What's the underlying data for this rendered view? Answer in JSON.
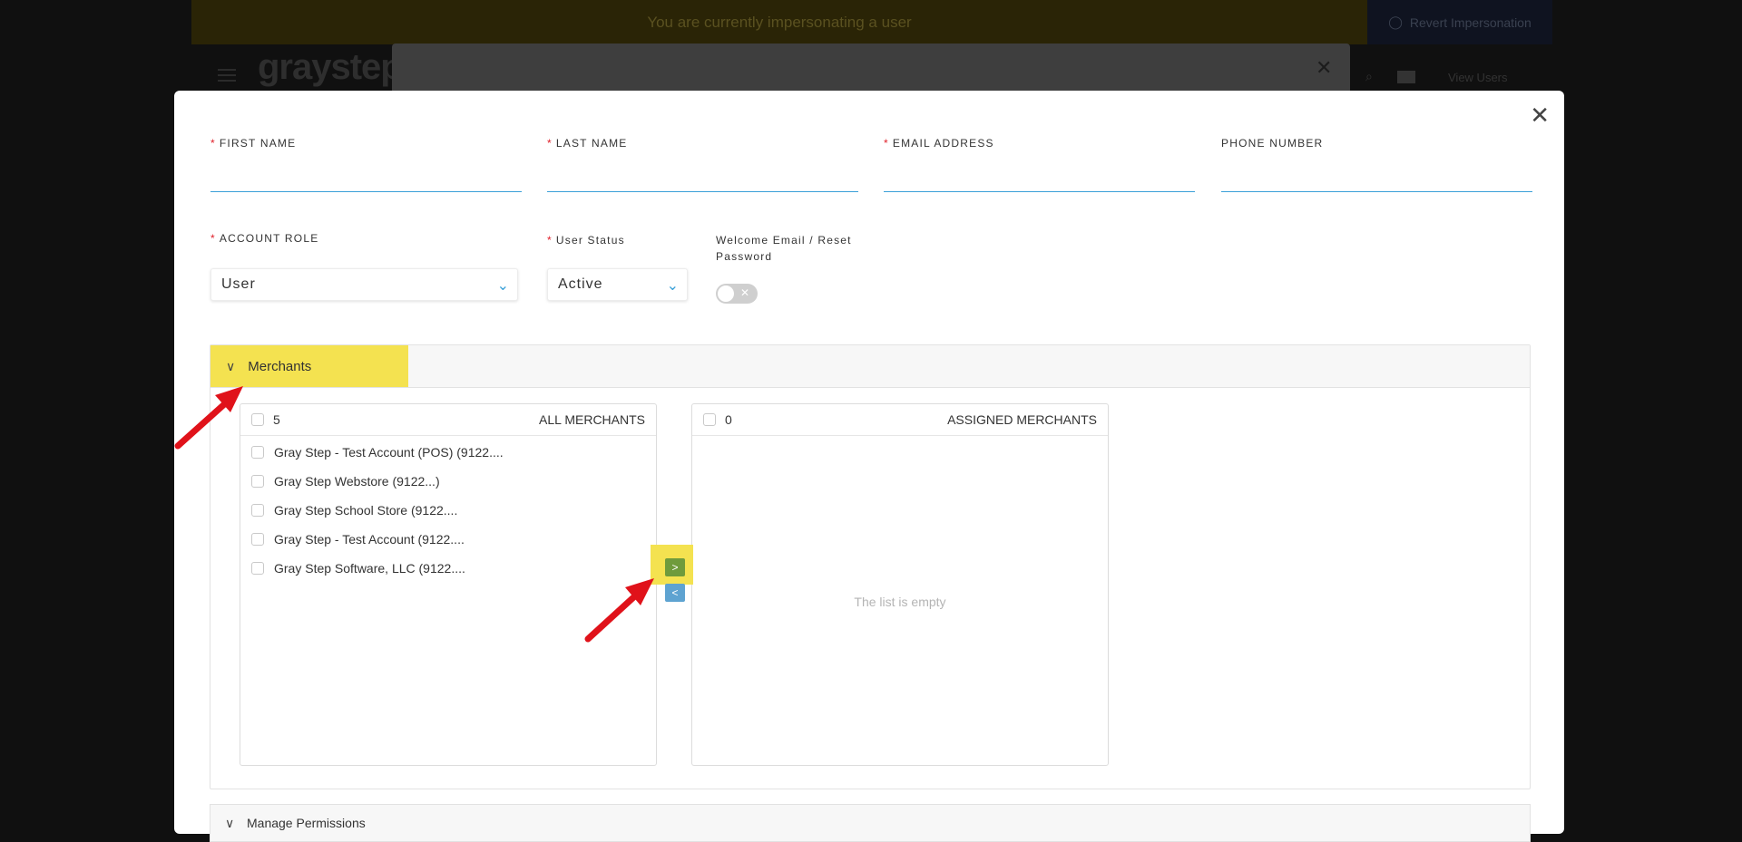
{
  "background": {
    "banner_text": "You are currently impersonating a user",
    "revert_label": "Revert Impersonation",
    "logo_text": "graystep",
    "user_text": "View Users"
  },
  "form": {
    "first_name_label": "FIRST NAME",
    "last_name_label": "LAST NAME",
    "email_label": "EMAIL ADDRESS",
    "phone_label": "PHONE NUMBER",
    "account_role_label": "ACCOUNT ROLE",
    "account_role_value": "User",
    "user_status_label": "User Status",
    "user_status_value": "Active",
    "welcome_label": "Welcome Email / Reset Password"
  },
  "merchants": {
    "tab_label": "Merchants",
    "all": {
      "count": "5",
      "title": "ALL MERCHANTS",
      "items": [
        "Gray Step - Test Account (POS) (9122....",
        "Gray Step Webstore (9122...)",
        "Gray Step School Store (9122....",
        "Gray Step - Test Account (9122....",
        "Gray Step Software, LLC (9122...."
      ]
    },
    "assigned": {
      "count": "0",
      "title": "ASSIGNED MERCHANTS",
      "empty_text": "The list is empty"
    }
  },
  "permissions": {
    "label": "Manage Permissions"
  },
  "colors": {
    "highlight": "#f4e250",
    "accent": "#3aa0d8",
    "move_right": "#6f9b3c",
    "move_left": "#5ea3d1",
    "annotation_arrow": "#e0121a"
  }
}
